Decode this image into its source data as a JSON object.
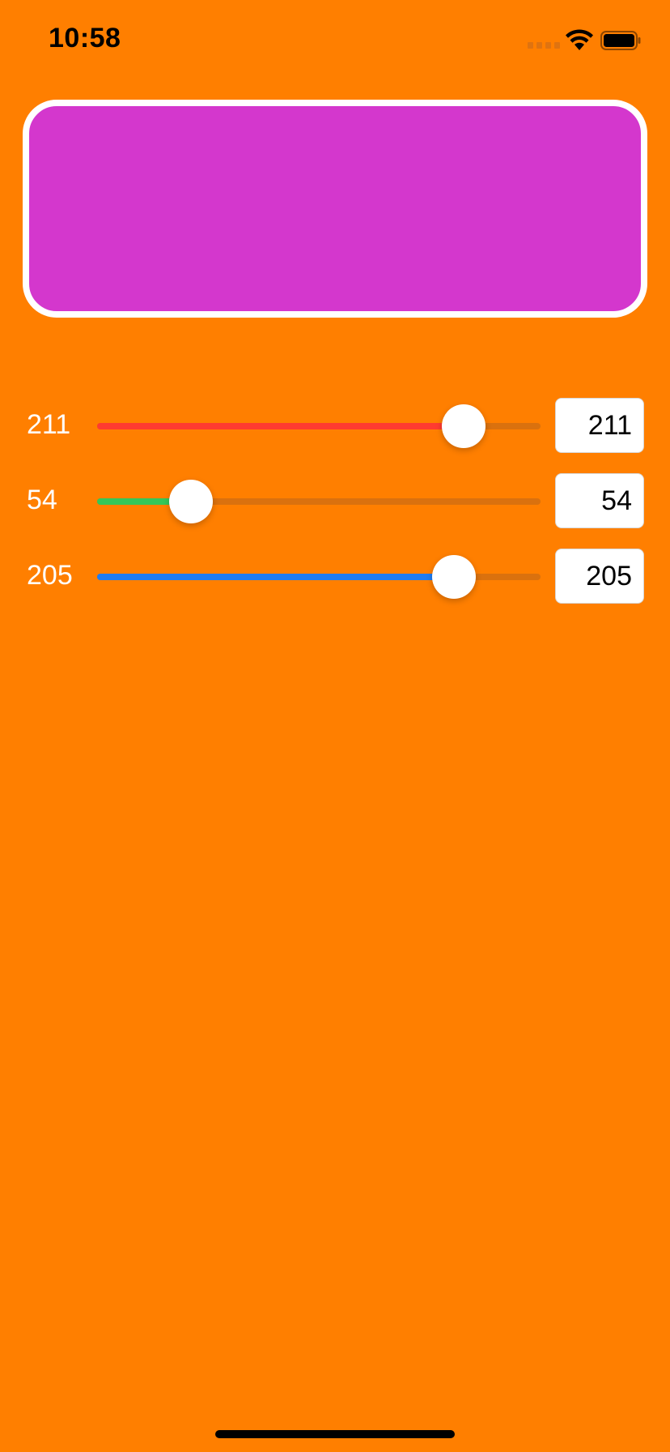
{
  "status_bar": {
    "time": "10:58",
    "icons": [
      "cellular-signal-icon",
      "wifi-icon",
      "battery-icon"
    ]
  },
  "preview": {
    "color": "#d437cd"
  },
  "background_color": "#ff7f00",
  "sliders": [
    {
      "channel": "red",
      "label": "211",
      "field_value": "211",
      "value": 211,
      "max": 255,
      "tint": "#ff3b30"
    },
    {
      "channel": "green",
      "label": "54",
      "field_value": "54",
      "value": 54,
      "max": 255,
      "tint": "#34c759"
    },
    {
      "channel": "blue",
      "label": "205",
      "field_value": "205",
      "value": 205,
      "max": 255,
      "tint": "#1e7cf2"
    }
  ]
}
